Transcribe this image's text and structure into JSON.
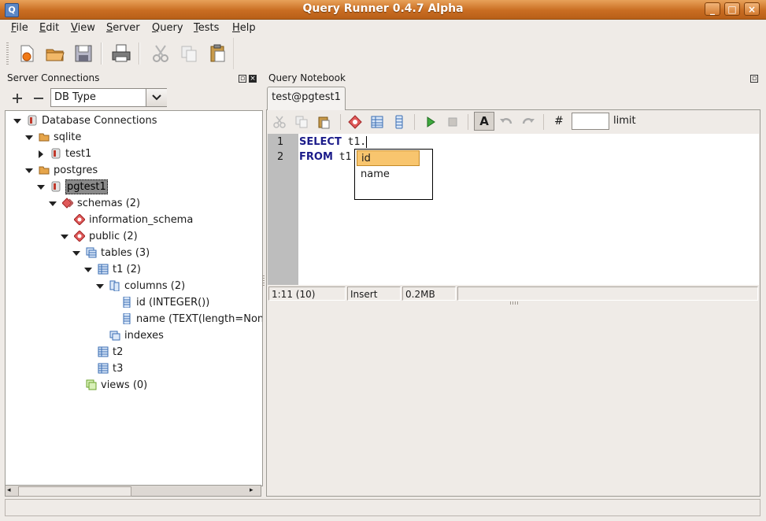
{
  "window": {
    "title": "Query Runner 0.4.7 Alpha",
    "app_icon_letter": "Q",
    "controls": [
      "_",
      "□",
      "×"
    ]
  },
  "menu": {
    "items": [
      {
        "label": "File",
        "mnemonic": "F",
        "rest": "ile"
      },
      {
        "label": "Edit",
        "mnemonic": "E",
        "rest": "dit"
      },
      {
        "label": "View",
        "mnemonic": "V",
        "rest": "iew"
      },
      {
        "label": "Server",
        "mnemonic": "S",
        "rest": "erver"
      },
      {
        "label": "Query",
        "mnemonic": "Q",
        "rest": "uery"
      },
      {
        "label": "Tests",
        "mnemonic": "T",
        "rest": "ests"
      },
      {
        "label": "Help",
        "mnemonic": "H",
        "rest": "elp"
      }
    ]
  },
  "toolbar": {
    "icons": [
      "new-icon",
      "open-icon",
      "save-icon",
      "print-icon",
      "cut-icon",
      "copy-icon",
      "paste-icon"
    ]
  },
  "server_panel": {
    "title": "Server Connections",
    "db_type": "DB Type",
    "tree": [
      {
        "label": "Database Connections",
        "icon": "database-icon",
        "depth": 0,
        "expanded": true
      },
      {
        "label": "sqlite",
        "icon": "folder-icon",
        "depth": 1,
        "expanded": true
      },
      {
        "label": "test1",
        "icon": "database-icon",
        "depth": 2,
        "expanded": false
      },
      {
        "label": "postgres",
        "icon": "folder-icon",
        "depth": 1,
        "expanded": true
      },
      {
        "label": "pgtest1",
        "icon": "database-icon",
        "depth": 2,
        "expanded": true,
        "selected": true
      },
      {
        "label": "schemas (2)",
        "icon": "schemas-icon",
        "depth": 3,
        "expanded": true
      },
      {
        "label": "information_schema",
        "icon": "schema-icon",
        "depth": 4
      },
      {
        "label": "public (2)",
        "icon": "schema-icon",
        "depth": 4,
        "expanded": true
      },
      {
        "label": "tables (3)",
        "icon": "tables-icon",
        "depth": 5,
        "expanded": true
      },
      {
        "label": "t1 (2)",
        "icon": "table-icon",
        "depth": 6,
        "expanded": true
      },
      {
        "label": "columns (2)",
        "icon": "columns-icon",
        "depth": 7,
        "expanded": true
      },
      {
        "label": "id (INTEGER())",
        "icon": "column-icon",
        "depth": 8
      },
      {
        "label": "name (TEXT(length=Non",
        "icon": "column-icon",
        "depth": 8
      },
      {
        "label": "indexes",
        "icon": "indexes-icon",
        "depth": 7
      },
      {
        "label": "t2",
        "icon": "table-icon",
        "depth": 6
      },
      {
        "label": "t3",
        "icon": "table-icon",
        "depth": 6
      },
      {
        "label": "views (0)",
        "icon": "views-icon",
        "depth": 5
      }
    ]
  },
  "notebook": {
    "title": "Query Notebook",
    "tab": "test@pgtest1",
    "toolbar": {
      "hash_label": "#",
      "limit_label": "limit",
      "limit_value": ""
    },
    "editor": {
      "lines": [
        {
          "no": "1",
          "kw": "SELECT",
          "rest": " t1."
        },
        {
          "no": "2",
          "kw": "FROM",
          "rest": " t1"
        }
      ]
    },
    "autocomplete": {
      "items": [
        "id",
        "name"
      ],
      "selected": "id"
    },
    "status": {
      "position": "1:11 (10)",
      "mode": "Insert",
      "memory": "0.2MB"
    }
  }
}
